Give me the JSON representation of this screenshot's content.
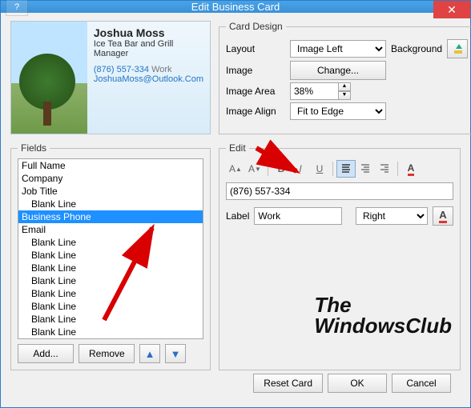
{
  "window": {
    "title": "Edit Business Card"
  },
  "preview": {
    "name": "Joshua Moss",
    "company": "Ice Tea Bar and Grill",
    "jobTitle": "Manager",
    "phone": "(876) 557-334",
    "phoneLabel": "Work",
    "email": "JoshuaMoss@Outlook.Com"
  },
  "cardDesign": {
    "legend": "Card Design",
    "layoutLabel": "Layout",
    "layoutValue": "Image Left",
    "backgroundLabel": "Background",
    "imageLabel": "Image",
    "changeBtn": "Change...",
    "imageAreaLabel": "Image Area",
    "imageAreaValue": "38%",
    "imageAlignLabel": "Image Align",
    "imageAlignValue": "Fit to Edge"
  },
  "fields": {
    "legend": "Fields",
    "items": [
      {
        "label": "Full Name",
        "indent": false,
        "selected": false
      },
      {
        "label": "Company",
        "indent": false,
        "selected": false
      },
      {
        "label": "Job Title",
        "indent": false,
        "selected": false
      },
      {
        "label": "Blank Line",
        "indent": true,
        "selected": false
      },
      {
        "label": "Business Phone",
        "indent": false,
        "selected": true
      },
      {
        "label": "Email",
        "indent": false,
        "selected": false
      },
      {
        "label": "Blank Line",
        "indent": true,
        "selected": false
      },
      {
        "label": "Blank Line",
        "indent": true,
        "selected": false
      },
      {
        "label": "Blank Line",
        "indent": true,
        "selected": false
      },
      {
        "label": "Blank Line",
        "indent": true,
        "selected": false
      },
      {
        "label": "Blank Line",
        "indent": true,
        "selected": false
      },
      {
        "label": "Blank Line",
        "indent": true,
        "selected": false
      },
      {
        "label": "Blank Line",
        "indent": true,
        "selected": false
      },
      {
        "label": "Blank Line",
        "indent": true,
        "selected": false
      }
    ],
    "addBtn": "Add...",
    "removeBtn": "Remove"
  },
  "edit": {
    "legend": "Edit",
    "value": "(876) 557-334",
    "labelLabel": "Label",
    "labelValue": "Work",
    "alignValue": "Right"
  },
  "footer": {
    "reset": "Reset Card",
    "ok": "OK",
    "cancel": "Cancel"
  },
  "brand": {
    "line1": "The",
    "line2": "WindowsClub"
  }
}
